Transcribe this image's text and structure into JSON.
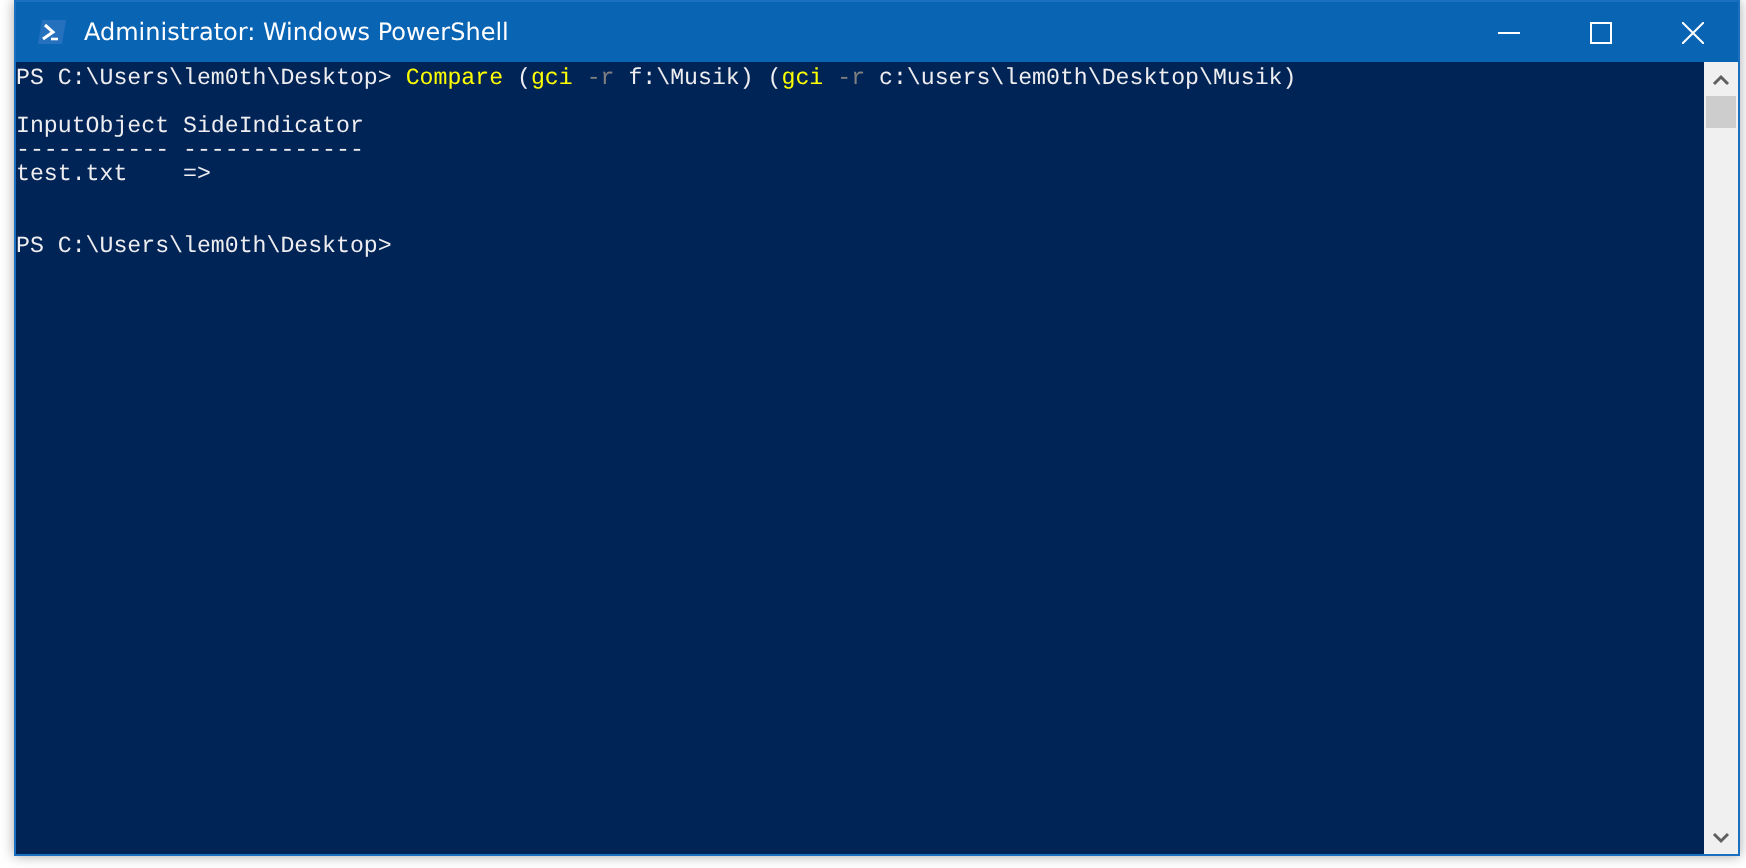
{
  "window": {
    "title": "Administrator: Windows PowerShell"
  },
  "console": {
    "blocks": [
      {
        "prompt": "PS C:\\Users\\lem0th\\Desktop>",
        "command": [
          {
            "text": "Compare",
            "kind": "command"
          },
          {
            "text": "(",
            "kind": "plain"
          },
          {
            "text": "gci",
            "kind": "command"
          },
          {
            "text": "-r",
            "kind": "parameter"
          },
          {
            "text": "f:\\Musik)",
            "kind": "plain"
          },
          {
            "text": "(",
            "kind": "plain"
          },
          {
            "text": "gci",
            "kind": "command"
          },
          {
            "text": "-r",
            "kind": "parameter"
          },
          {
            "text": "c:\\users\\lem0th\\Desktop\\Musik)",
            "kind": "plain"
          }
        ],
        "output": [
          "InputObject SideIndicator",
          "----------- -------------",
          "test.txt    =>"
        ]
      },
      {
        "prompt": "PS C:\\Users\\lem0th\\Desktop>"
      }
    ]
  }
}
